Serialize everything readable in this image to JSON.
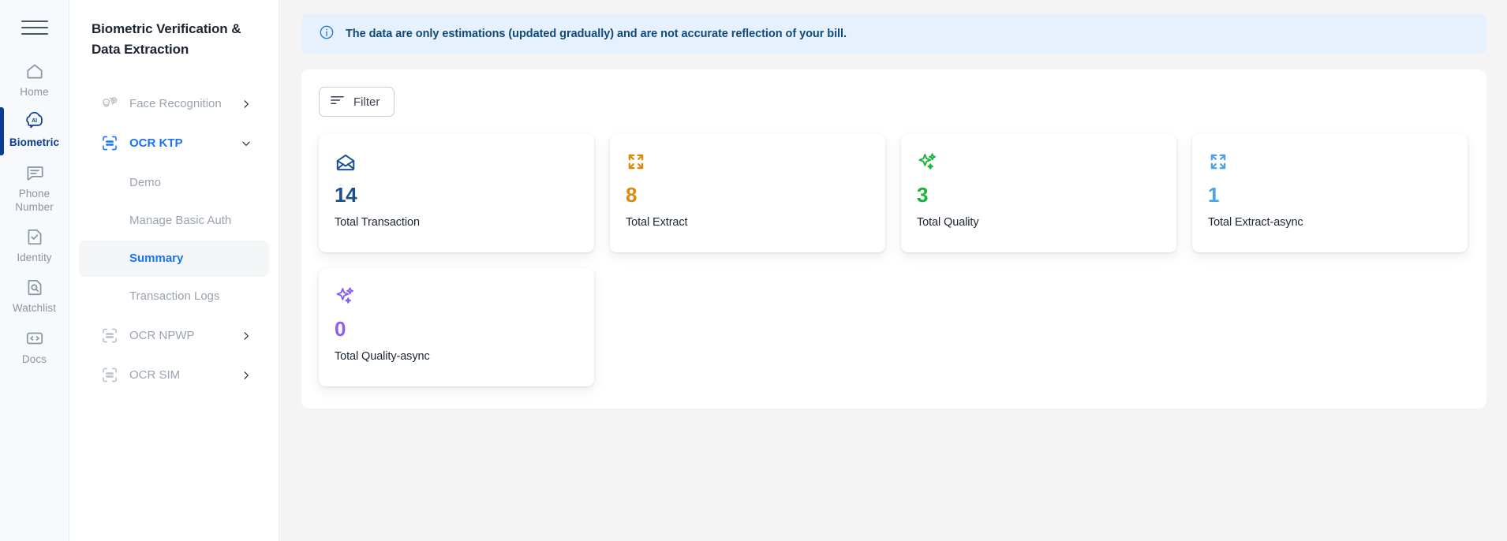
{
  "rail": {
    "menu_icon": "hamburger-icon",
    "items": [
      {
        "label": "Home",
        "icon": "home-icon",
        "active": false
      },
      {
        "label": "Biometric",
        "icon": "ai-brain-icon",
        "active": true
      },
      {
        "label": "Phone Number",
        "icon": "message-icon",
        "active": false
      },
      {
        "label": "Identity",
        "icon": "document-check-icon",
        "active": false
      },
      {
        "label": "Watchlist",
        "icon": "document-search-icon",
        "active": false
      },
      {
        "label": "Docs",
        "icon": "code-icon",
        "active": false
      }
    ],
    "active_color": "#0b3c91"
  },
  "sidebar": {
    "title": "Biometric Verification & Data Extraction",
    "nav": [
      {
        "label": "Face Recognition",
        "icon": "face-masks-icon",
        "chevron": "chevron-right-icon",
        "active": false
      },
      {
        "label": "OCR KTP",
        "icon": "scan-card-icon",
        "chevron": "chevron-down-icon",
        "active": true
      },
      {
        "label": "OCR NPWP",
        "icon": "scan-card-icon",
        "chevron": "chevron-right-icon",
        "active": false
      },
      {
        "label": "OCR SIM",
        "icon": "scan-card-icon",
        "chevron": "chevron-right-icon",
        "active": false
      }
    ],
    "sub_items": [
      {
        "label": "Demo",
        "selected": false
      },
      {
        "label": "Manage Basic Auth",
        "selected": false
      },
      {
        "label": "Summary",
        "selected": true
      },
      {
        "label": "Transaction Logs",
        "selected": false
      }
    ],
    "active_color": "#1a73f0"
  },
  "main": {
    "banner": {
      "icon": "info-circle-icon",
      "text": "The data are only estimations (updated gradually) and are not accurate reflection of your bill.",
      "bg_color": "#e7f1fd",
      "text_color": "#0f4a7a"
    },
    "filter": {
      "label": "Filter",
      "icon": "filter-lines-icon"
    },
    "cards": [
      {
        "value": "14",
        "label": "Total Transaction",
        "icon": "open-envelope-icon",
        "color": "#1b4f92"
      },
      {
        "value": "8",
        "label": "Total Extract",
        "icon": "expand-arrows-icon",
        "color": "#d98a0b"
      },
      {
        "value": "3",
        "label": "Total Quality",
        "icon": "sparkles-icon",
        "color": "#17b437"
      },
      {
        "value": "1",
        "label": "Total Extract-async",
        "icon": "expand-arrows-icon",
        "color": "#4aa3ef"
      },
      {
        "value": "0",
        "label": "Total Quality-async",
        "icon": "sparkles-icon",
        "color": "#8b5cf6"
      }
    ]
  }
}
